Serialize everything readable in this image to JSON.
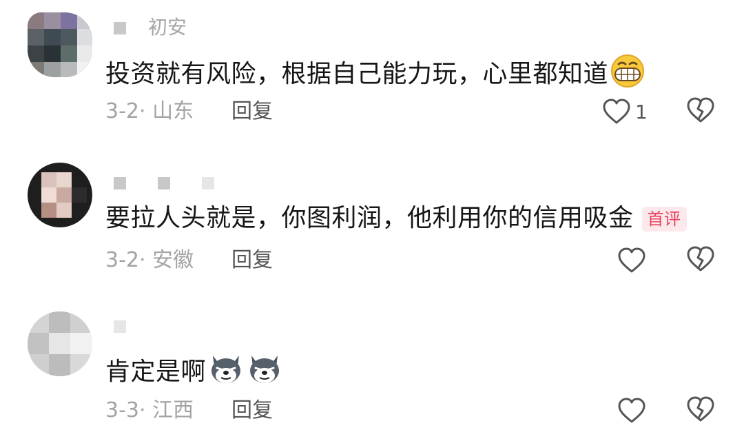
{
  "comments": [
    {
      "username": " 初安",
      "text": "投资就有风险，根据自己能力玩，心里都知道",
      "emoji": "grin-emoji",
      "badge": "",
      "date": "3-2",
      "location": "山东",
      "reply_label": "回复",
      "like_count": "1"
    },
    {
      "username": "",
      "text": "要拉人头就是，你图利润，他利用你的信用吸金",
      "emoji": "",
      "badge": "首评",
      "date": "3-2",
      "location": "安徽",
      "reply_label": "回复",
      "like_count": ""
    },
    {
      "username": "",
      "text": "肯定是啊",
      "emoji": "husky-emoji",
      "badge": "",
      "date": "3-3",
      "location": "江西",
      "reply_label": "回复",
      "like_count": ""
    }
  ],
  "meta_separator": "·",
  "colors": {
    "text": "#161616",
    "meta": "#a3a3a3",
    "reply": "#555555",
    "badge_bg": "#fde8ec",
    "badge_fg": "#e8425c"
  }
}
